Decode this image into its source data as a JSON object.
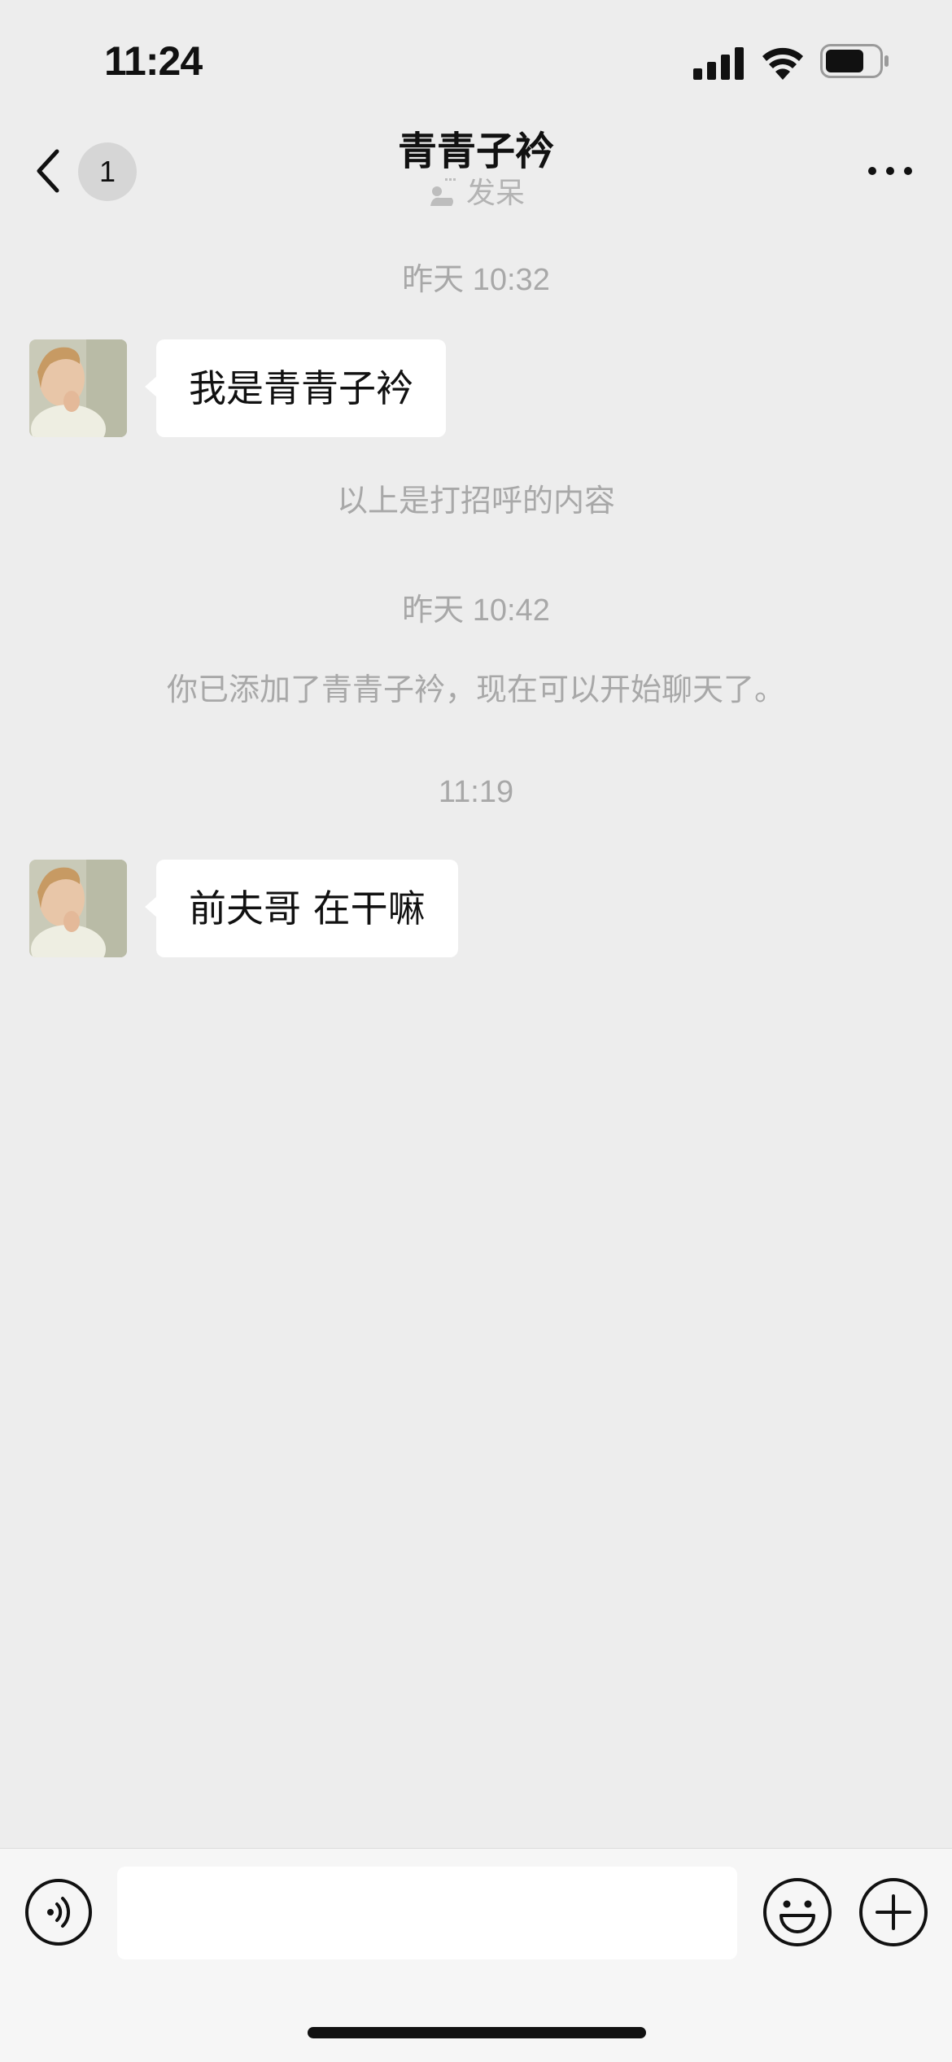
{
  "status_bar": {
    "time": "11:24"
  },
  "nav": {
    "unread_count": "1",
    "title": "青青子衿",
    "status": "发呆"
  },
  "messages": [
    {
      "type": "timestamp",
      "text": "昨天 10:32"
    },
    {
      "type": "incoming",
      "text": "我是青青子衿"
    },
    {
      "type": "system",
      "text": "以上是打招呼的内容"
    },
    {
      "type": "timestamp",
      "text": "昨天 10:42"
    },
    {
      "type": "system",
      "text": "你已添加了青青子衿，现在可以开始聊天了。"
    },
    {
      "type": "timestamp",
      "text": "11:19"
    },
    {
      "type": "incoming",
      "text": "前夫哥 在干嘛"
    }
  ],
  "input": {
    "value": "",
    "placeholder": ""
  },
  "colors": {
    "background": "#ededed",
    "bubble": "#ffffff",
    "meta_text": "#a8a8a8",
    "input_bar": "#f6f6f6"
  },
  "icons": {
    "back": "chevron-left-icon",
    "more": "more-dots-icon",
    "voice": "voice-icon",
    "emoji": "emoji-icon",
    "plus": "plus-icon",
    "status": "status-idle-icon"
  }
}
